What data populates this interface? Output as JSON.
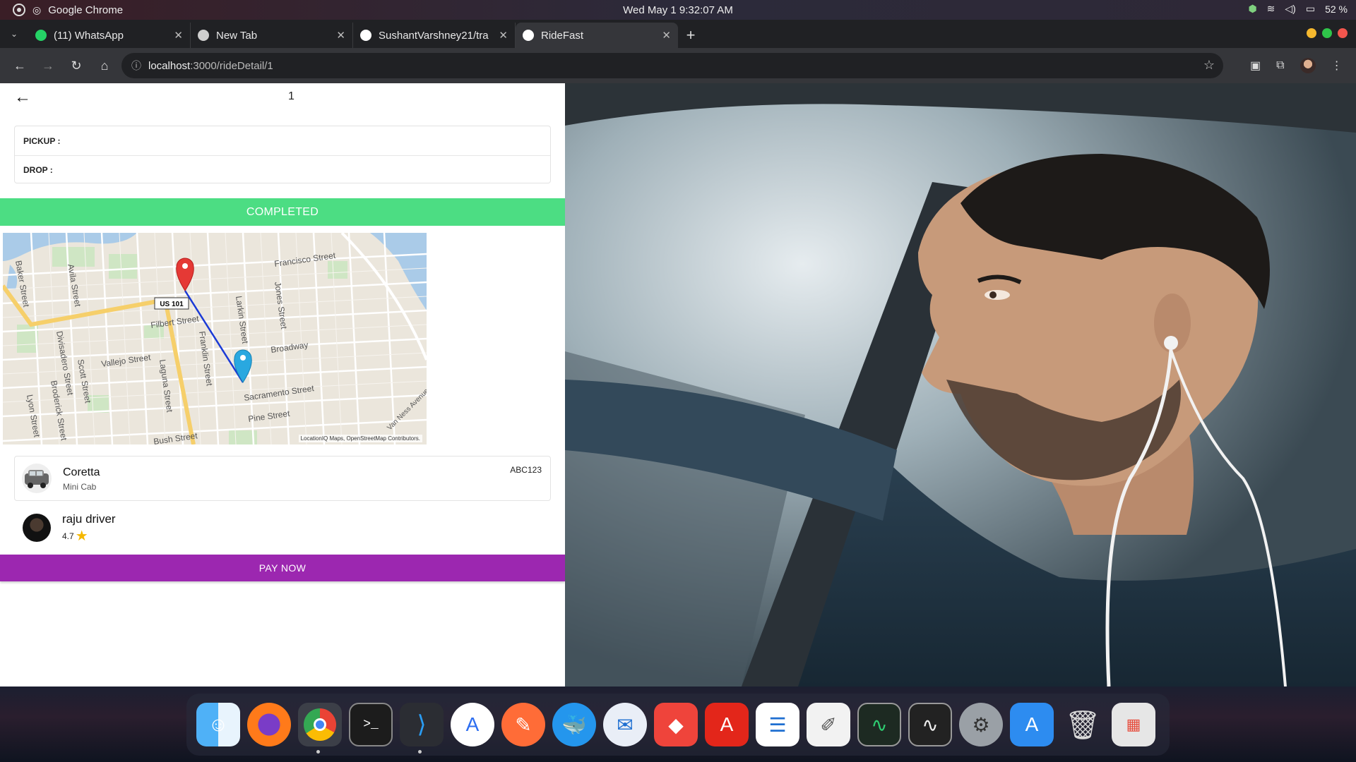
{
  "os": {
    "app_name": "Google Chrome",
    "clock": "Wed May 1  9:32:07 AM",
    "battery": "52 %"
  },
  "tabs": [
    {
      "label": "(11) WhatsApp",
      "icon": "whatsapp-icon",
      "color": "#25d366"
    },
    {
      "label": "New Tab",
      "icon": "chrome-icon",
      "color": "#cfcfcf"
    },
    {
      "label": "SushantVarshney21/tra",
      "icon": "github-icon",
      "color": "#ffffff"
    },
    {
      "label": "RideFast",
      "icon": "ridefast-icon",
      "color": "#ffffff",
      "active": true
    }
  ],
  "address": {
    "host": "localhost",
    "path": ":3000/rideDetail/1"
  },
  "ride": {
    "id": "1",
    "pickup_label": "PICKUP :",
    "drop_label": "DROP :",
    "status": "COMPLETED",
    "status_color": "#4cdd83"
  },
  "map": {
    "attribution": "LocationIQ Maps, OpenStreetMap Contributors.",
    "streets": [
      "Francisco Street",
      "Baker Street",
      "Avila Street",
      "Filbert Street",
      "Larkin Street",
      "Jones Street",
      "Broadway",
      "Vallejo Street",
      "Franklin Street",
      "Divisadero Street",
      "Scott Street",
      "Laguna Street",
      "Sacramento Street",
      "Broderick Street",
      "Lyon Street",
      "Pine Street",
      "Bush Street",
      "Van Ness Avenue"
    ],
    "highway_shield": "US 101"
  },
  "vehicle": {
    "name": "Coretta",
    "type": "Mini Cab",
    "plate": "ABC123"
  },
  "driver": {
    "name": "raju driver",
    "rating": "4.7"
  },
  "actions": {
    "pay_label": "PAY NOW",
    "pay_color": "#9c27b0"
  },
  "dock": [
    "finder-icon",
    "firefox-icon",
    "chrome-icon",
    "terminal-icon",
    "vscode-icon",
    "app-store-icon",
    "postman-icon",
    "docker-icon",
    "thunderbird-icon",
    "anydesk-icon",
    "acrobat-icon",
    "text-editor-icon",
    "script-editor-icon",
    "activity-monitor-icon",
    "system-monitor-icon",
    "settings-icon",
    "software-update-icon",
    "trash-icon",
    "launchpad-icon"
  ]
}
